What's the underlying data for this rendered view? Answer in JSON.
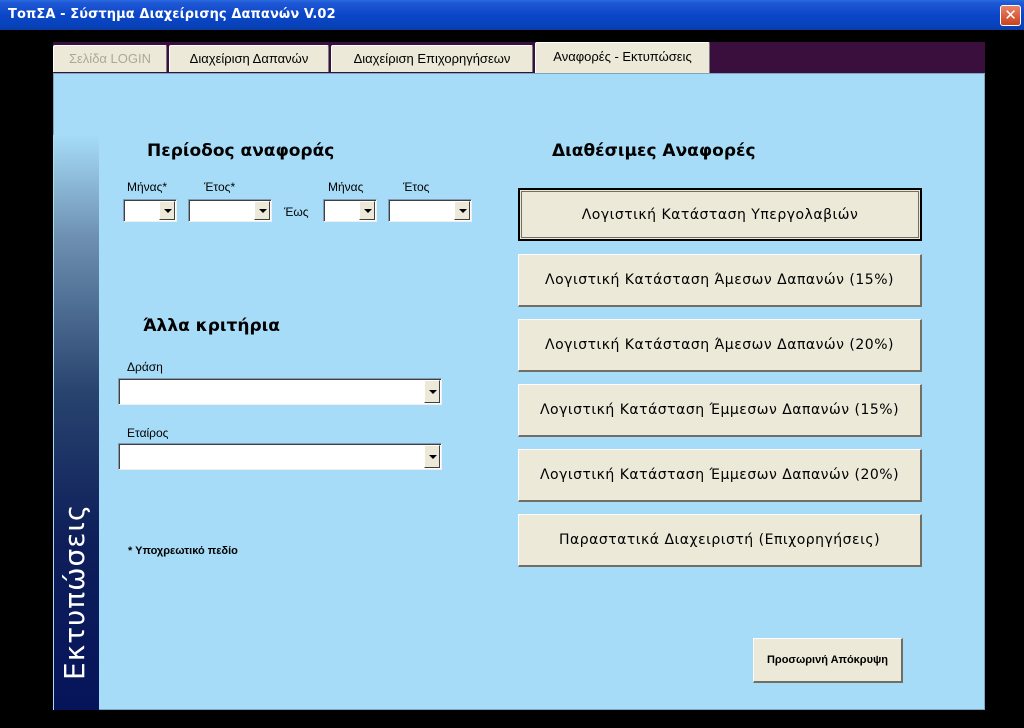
{
  "window": {
    "title": "ΤοπΣΑ - Σύστημα Διαχείρισης Δαπανών   V.02",
    "close_glyph": "✕"
  },
  "tabs": [
    {
      "label": "Σελίδα LOGIN",
      "state": "disabled"
    },
    {
      "label": "Διαχείριση Δαπανών",
      "state": "normal"
    },
    {
      "label": "Διαχείριση Επιχορηγήσεων",
      "state": "normal"
    },
    {
      "label": "Αναφορές - Εκτυπώσεις",
      "state": "active"
    }
  ],
  "sidebar": {
    "label": "Εκτυπώσεις"
  },
  "period": {
    "heading": "Περίοδος αναφοράς",
    "from_month_label": "Μήνας*",
    "from_year_label": "Έτος*",
    "to_label": "Έως",
    "to_month_label": "Μήνας",
    "to_year_label": "Έτος",
    "from_month_value": "",
    "from_year_value": "",
    "to_month_value": "",
    "to_year_value": ""
  },
  "criteria": {
    "heading": "Άλλα κριτήρια",
    "action_label": "Δράση",
    "action_value": "",
    "partner_label": "Εταίρος",
    "partner_value": ""
  },
  "required_note": "*  Υποχρεωτικό πεδίο",
  "reports": {
    "heading": "Διαθέσιμες Αναφορές",
    "buttons": [
      "Λογιστική Κατάσταση Υπεργολαβιών",
      "Λογιστική Κατάσταση Άμεσων Δαπανών (15%)",
      "Λογιστική Κατάσταση Άμεσων Δαπανών (20%)",
      "Λογιστική Κατάσταση Έμμεσων Δαπανών (15%)",
      "Λογιστική Κατάσταση Έμμεσων Δαπανών (20%)",
      "Παραστατικά Διαχειριστή (Επιχορηγήσεις)"
    ]
  },
  "hide_button": "Προσωρινή Απόκρυψη",
  "colors": {
    "panel_bg": "#a6dcf7",
    "tabstrip_bg": "#3a0f3e",
    "button_face": "#ece9d8",
    "sidebar_dark": "#06145a"
  }
}
